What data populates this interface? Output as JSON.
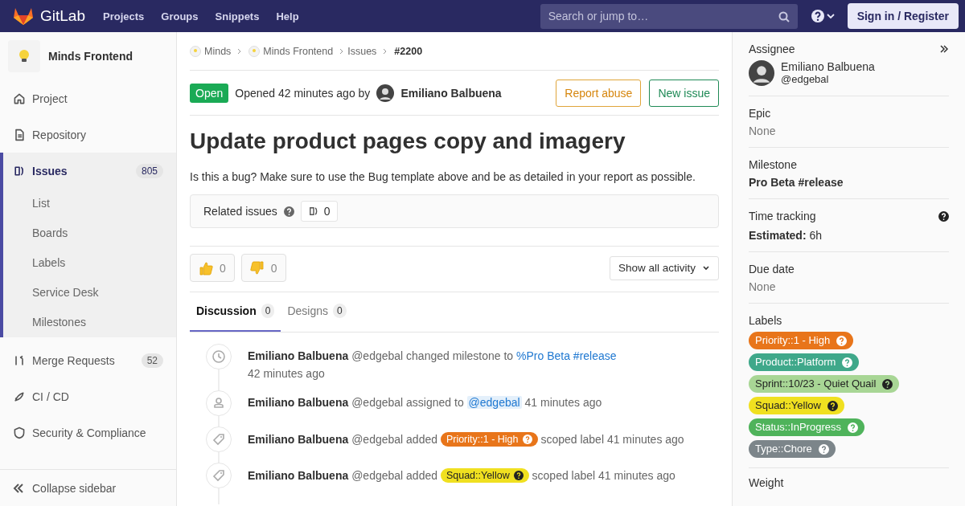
{
  "topbar": {
    "brand": "GitLab",
    "nav": [
      "Projects",
      "Groups",
      "Snippets",
      "Help"
    ],
    "search": {
      "placeholder": "Search or jump to…"
    },
    "signin": "Sign in / Register"
  },
  "sidebar": {
    "project": "Minds Frontend",
    "items": [
      {
        "label": "Project",
        "selected": false
      },
      {
        "label": "Repository",
        "selected": false
      },
      {
        "label": "Issues",
        "count": "805",
        "selected": true,
        "children": [
          {
            "label": "List"
          },
          {
            "label": "Boards"
          },
          {
            "label": "Labels"
          },
          {
            "label": "Service Desk"
          },
          {
            "label": "Milestones"
          }
        ]
      },
      {
        "label": "Merge Requests",
        "count": "52",
        "selected": false
      },
      {
        "label": "CI / CD",
        "selected": false
      },
      {
        "label": "Security & Compliance",
        "selected": false
      }
    ],
    "collapse": "Collapse sidebar"
  },
  "breadcrumbs": [
    "Minds",
    "Minds Frontend",
    "Issues",
    "#2200"
  ],
  "issue": {
    "status": "Open",
    "opened": "Opened 42 minutes ago by",
    "author": "Emiliano Balbuena",
    "buttons": [
      "Report abuse",
      "New issue"
    ],
    "title": "Update product pages copy and imagery",
    "description": "Is this a bug? Make sure to use the Bug template above and be as detailed in your report as possible.",
    "related": {
      "label": "Related issues",
      "count": "0"
    }
  },
  "reactions": [
    {
      "kind": "up",
      "count": "0"
    },
    {
      "kind": "down",
      "count": "0"
    }
  ],
  "activity_filter": "Show all activity",
  "tabs": [
    {
      "label": "Discussion",
      "count": "0",
      "selected": true
    },
    {
      "label": "Designs",
      "count": "0",
      "selected": false
    }
  ],
  "events": [
    {
      "kind": "milestone",
      "author": "Emiliano Balbuena",
      "handle": "@edgebal",
      "action": "changed milestone to",
      "link": "%Pro Beta #release",
      "time": "42 minutes ago"
    },
    {
      "kind": "assign",
      "author": "Emiliano Balbuena",
      "handle": "@edgebal",
      "action": "assigned to",
      "mention": "@edgebal",
      "time": "41 minutes ago"
    },
    {
      "kind": "label",
      "author": "Emiliano Balbuena",
      "handle": "@edgebal",
      "action": "added",
      "label": {
        "text": "Priority::1 - High",
        "color": "#e8751a"
      },
      "after": "scoped label",
      "time": "41 minutes ago"
    },
    {
      "kind": "label",
      "author": "Emiliano Balbuena",
      "handle": "@edgebal",
      "action": "added",
      "label": {
        "text": "Squad::Yellow",
        "color": "#f0e020"
      },
      "after": "scoped label",
      "time": "41 minutes ago"
    }
  ],
  "rightbar": {
    "assignee": {
      "heading": "Assignee",
      "name": "Emiliano Balbuena",
      "handle": "@edgebal"
    },
    "epic": {
      "heading": "Epic",
      "value": "None"
    },
    "milestone": {
      "heading": "Milestone",
      "value": "Pro Beta #release"
    },
    "time": {
      "heading": "Time tracking",
      "label": "Estimated:",
      "value": "6h"
    },
    "due": {
      "heading": "Due date",
      "value": "None"
    },
    "labels": {
      "heading": "Labels",
      "items": [
        {
          "text": "Priority::1 - High",
          "color": "#e8751a"
        },
        {
          "text": "Product::Platform",
          "color": "#3fa88a"
        },
        {
          "text": "Sprint::10/23 - Quiet Quail",
          "color": "#a8d695"
        },
        {
          "text": "Squad::Yellow",
          "color": "#f0e020"
        },
        {
          "text": "Status::InProgress",
          "color": "#4fb35b"
        },
        {
          "text": "Type::Chore",
          "color": "#7c858a"
        }
      ]
    },
    "weight": {
      "heading": "Weight"
    }
  }
}
